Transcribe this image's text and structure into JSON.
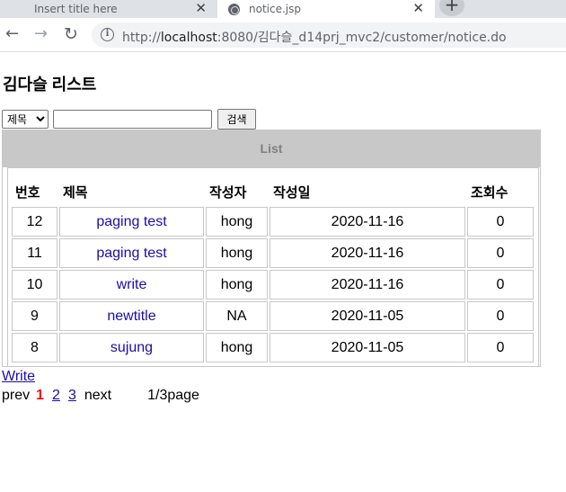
{
  "browser": {
    "tabs": [
      {
        "title": "Insert title here",
        "active": false
      },
      {
        "title": "notice.jsp",
        "active": true
      }
    ],
    "url": {
      "scheme": "http://",
      "host": "localhost",
      "rest": ":8080/김다슬_d14prj_mvc2/customer/notice.do"
    }
  },
  "page": {
    "title": "김다슬 리스트",
    "search": {
      "selected_field": "제목",
      "query": "",
      "button_label": "검색"
    },
    "board": {
      "caption": "List",
      "columns": [
        "번호",
        "제목",
        "작성자",
        "작성일",
        "조회수"
      ],
      "rows": [
        {
          "no": "12",
          "title": "paging test",
          "author": "hong",
          "date": "2020-11-16",
          "hits": "0"
        },
        {
          "no": "11",
          "title": "paging test",
          "author": "hong",
          "date": "2020-11-16",
          "hits": "0"
        },
        {
          "no": "10",
          "title": "write",
          "author": "hong",
          "date": "2020-11-16",
          "hits": "0"
        },
        {
          "no": "9",
          "title": "newtitle",
          "author": "NA",
          "date": "2020-11-05",
          "hits": "0"
        },
        {
          "no": "8",
          "title": "sujung",
          "author": "hong",
          "date": "2020-11-05",
          "hits": "0"
        }
      ]
    },
    "write_link": "Write",
    "pager": {
      "prev": "prev",
      "current": "1",
      "pages": [
        "2",
        "3"
      ],
      "next": "next",
      "page_count": "1/3page"
    }
  },
  "colors": {
    "link": "#1a0dab",
    "current_page": "#ff0000",
    "board_header_bg": "#c8c8c8"
  }
}
